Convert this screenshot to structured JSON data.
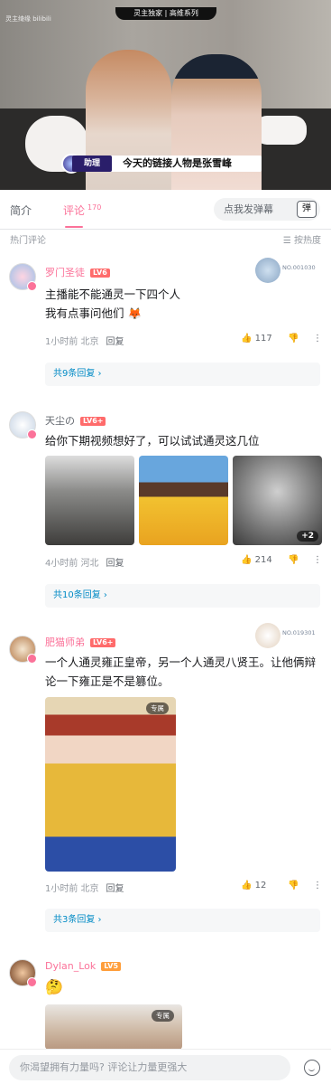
{
  "video": {
    "banner": "灵主独家 | 高维系列",
    "logo": "灵主绮缘 bilibili",
    "caption_tag": "助理",
    "caption": "今天的链接人物是张雪峰"
  },
  "tabs": {
    "intro": "简介",
    "comments": "评论",
    "comment_count": "170"
  },
  "danmaku": {
    "placeholder": "点我发弹幕",
    "button": "弹"
  },
  "sort_bar": {
    "hot": "热门评论",
    "sort": "按热度"
  },
  "comments": [
    {
      "name": "罗门圣徒",
      "level": "LV6",
      "lines": [
        "主播能不能通灵一下四个人",
        "我有点事问他们 🦊"
      ],
      "time": "1小时前 北京",
      "reply": "回复",
      "likes": "117",
      "replies": "共9条回复 ›",
      "fan_no": "NO.001030"
    },
    {
      "name": "天尘の",
      "level": "LV6+",
      "lines": [
        "给你下期视频想好了，可以试试通灵这几位"
      ],
      "more_images": "+2",
      "time": "4小时前 河北",
      "reply": "回复",
      "likes": "214",
      "replies": "共10条回复 ›"
    },
    {
      "name": "肥猫师弟",
      "level": "LV6+",
      "lines": [
        "一个人通灵雍正皇帝，另一个人通灵八贤王。让他俩辩论一下雍正是不是篡位。"
      ],
      "badge": "专属",
      "time": "1小时前 北京",
      "reply": "回复",
      "likes": "12",
      "replies": "共3条回复 ›",
      "fan_no": "NO.019301"
    },
    {
      "name": "Dylan_Lok",
      "level": "LV5",
      "lines": [
        "🤔"
      ],
      "badge": "专属"
    }
  ],
  "input": {
    "placeholder": "你渴望拥有力量吗? 评论让力量更强大"
  },
  "colors": {
    "accent": "#fb7299",
    "link": "#008ac5"
  }
}
